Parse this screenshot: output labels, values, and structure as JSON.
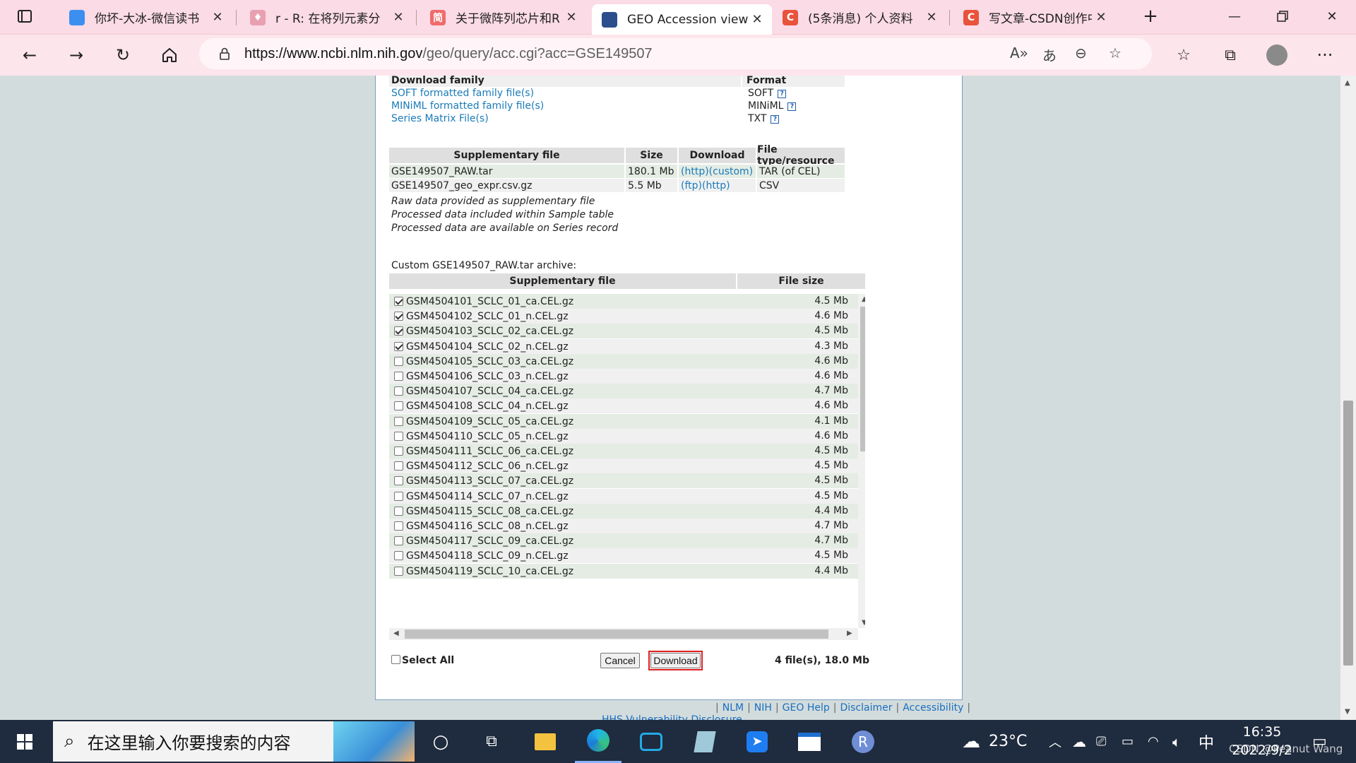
{
  "browser": {
    "tabs": [
      {
        "title": "你坏-大冰-微信读书",
        "color": "#3b8ff0",
        "glyph": "",
        "active": false
      },
      {
        "title": "r - R: 在将列元素分",
        "color": "#e8a0b0",
        "glyph": "♦",
        "active": false
      },
      {
        "title": "关于微阵列芯片和R",
        "color": "#f06b6b",
        "glyph": "简",
        "active": false
      },
      {
        "title": "GEO Accession viewer",
        "color": "#2b4f8c",
        "glyph": "",
        "active": true
      },
      {
        "title": "(5条消息) 个人资料",
        "color": "#e9523b",
        "glyph": "C",
        "active": false
      },
      {
        "title": "写文章-CSDN创作中",
        "color": "#e9523b",
        "glyph": "C",
        "active": false
      }
    ],
    "url_host": "https://www.ncbi.nlm.nih.gov",
    "url_path": "/geo/query/acc.cgi?acc=GSE149507"
  },
  "family": {
    "header_download": "Download family",
    "header_format": "Format",
    "rows": [
      {
        "link": "SOFT formatted family file(s)",
        "format": "SOFT"
      },
      {
        "link": "MINiML formatted family file(s)",
        "format": "MINiML"
      },
      {
        "link": "Series Matrix File(s)",
        "format": "TXT"
      }
    ],
    "help_glyph": "?"
  },
  "supp": {
    "headers": [
      "Supplementary file",
      "Size",
      "Download",
      "File type/resource"
    ],
    "rows": [
      {
        "file": "GSE149507_RAW.tar",
        "size": "180.1 Mb",
        "dl": "(http)(custom)",
        "type": "TAR (of CEL)"
      },
      {
        "file": "GSE149507_geo_expr.csv.gz",
        "size": "5.5 Mb",
        "dl": "(ftp)(http)",
        "type": "CSV"
      }
    ],
    "notes": [
      "Raw data provided as supplementary file",
      "Processed data included within Sample table",
      "Processed data are available on Series record"
    ]
  },
  "custom": {
    "caption": "Custom GSE149507_RAW.tar archive:",
    "headers": [
      "Supplementary file",
      "File size"
    ],
    "files": [
      {
        "name": "GSM4504101_SCLC_01_ca.CEL.gz",
        "size": "4.5 Mb",
        "checked": true
      },
      {
        "name": "GSM4504102_SCLC_01_n.CEL.gz",
        "size": "4.6 Mb",
        "checked": true
      },
      {
        "name": "GSM4504103_SCLC_02_ca.CEL.gz",
        "size": "4.5 Mb",
        "checked": true
      },
      {
        "name": "GSM4504104_SCLC_02_n.CEL.gz",
        "size": "4.3 Mb",
        "checked": true
      },
      {
        "name": "GSM4504105_SCLC_03_ca.CEL.gz",
        "size": "4.6 Mb",
        "checked": false
      },
      {
        "name": "GSM4504106_SCLC_03_n.CEL.gz",
        "size": "4.6 Mb",
        "checked": false
      },
      {
        "name": "GSM4504107_SCLC_04_ca.CEL.gz",
        "size": "4.7 Mb",
        "checked": false
      },
      {
        "name": "GSM4504108_SCLC_04_n.CEL.gz",
        "size": "4.6 Mb",
        "checked": false
      },
      {
        "name": "GSM4504109_SCLC_05_ca.CEL.gz",
        "size": "4.1 Mb",
        "checked": false
      },
      {
        "name": "GSM4504110_SCLC_05_n.CEL.gz",
        "size": "4.6 Mb",
        "checked": false
      },
      {
        "name": "GSM4504111_SCLC_06_ca.CEL.gz",
        "size": "4.5 Mb",
        "checked": false
      },
      {
        "name": "GSM4504112_SCLC_06_n.CEL.gz",
        "size": "4.5 Mb",
        "checked": false
      },
      {
        "name": "GSM4504113_SCLC_07_ca.CEL.gz",
        "size": "4.5 Mb",
        "checked": false
      },
      {
        "name": "GSM4504114_SCLC_07_n.CEL.gz",
        "size": "4.5 Mb",
        "checked": false
      },
      {
        "name": "GSM4504115_SCLC_08_ca.CEL.gz",
        "size": "4.4 Mb",
        "checked": false
      },
      {
        "name": "GSM4504116_SCLC_08_n.CEL.gz",
        "size": "4.7 Mb",
        "checked": false
      },
      {
        "name": "GSM4504117_SCLC_09_ca.CEL.gz",
        "size": "4.7 Mb",
        "checked": false
      },
      {
        "name": "GSM4504118_SCLC_09_n.CEL.gz",
        "size": "4.5 Mb",
        "checked": false
      },
      {
        "name": "GSM4504119_SCLC_10_ca.CEL.gz",
        "size": "4.4 Mb",
        "checked": false
      }
    ],
    "select_all": "Select All",
    "cancel": "Cancel",
    "download": "Download",
    "summary": "4 file(s), 18.0 Mb"
  },
  "footer": {
    "links": [
      "NLM",
      "NIH",
      "GEO Help",
      "Disclaimer",
      "Accessibility"
    ],
    "second": "HHS Vulnerability Disclosure"
  },
  "taskbar": {
    "search_placeholder": "在这里输入你要搜索的内容",
    "weather": "23°C",
    "ime": "中",
    "time": "16:35",
    "date": "2022/9/2",
    "watermark": "CSDN @Peanut Wang"
  },
  "colors": {
    "row_green": "#e4ece4",
    "row_grey": "#f0f0f0",
    "link": "#1a7bb9",
    "highlight": "#e02020"
  }
}
